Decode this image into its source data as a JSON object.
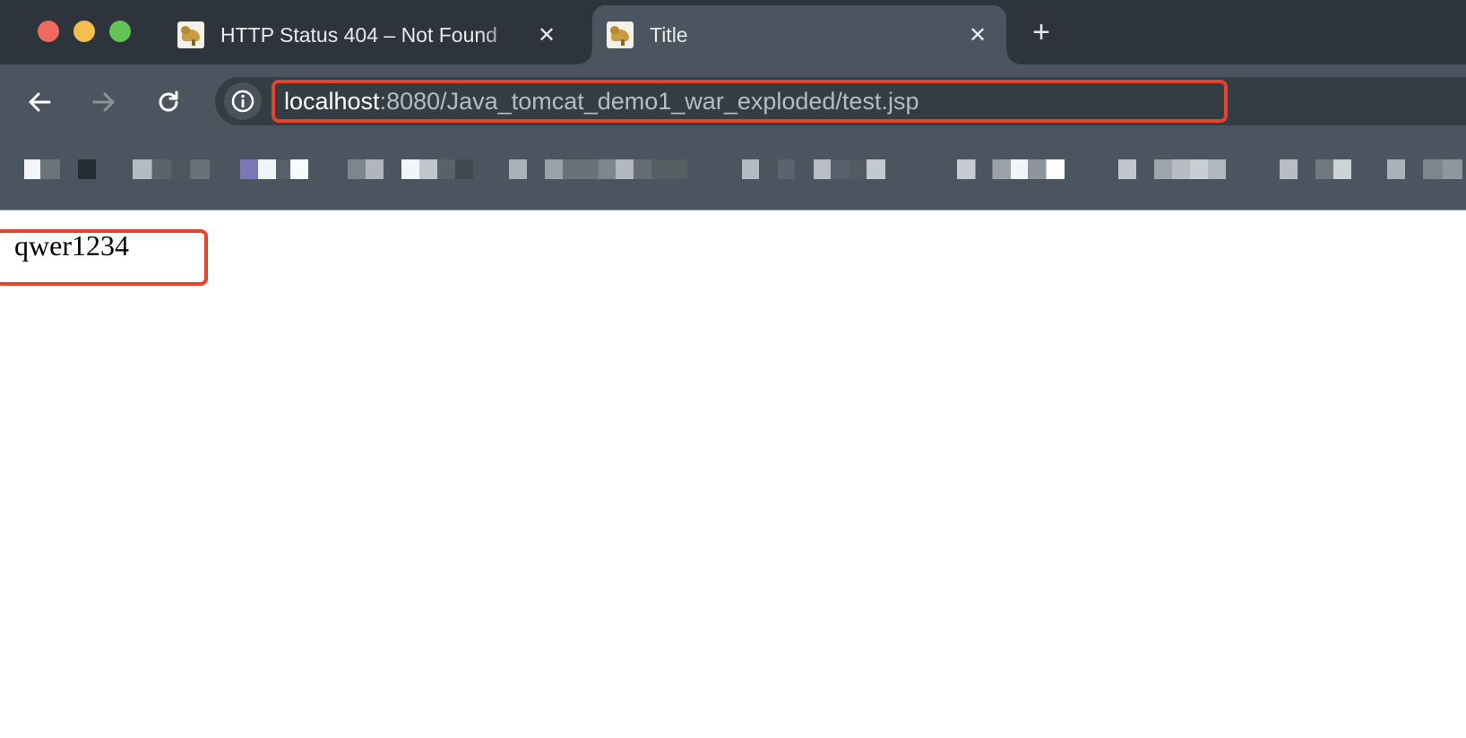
{
  "window": {
    "controls": [
      "close",
      "minimize",
      "zoom"
    ]
  },
  "tabs": [
    {
      "title": "HTTP Status 404 – Not Found",
      "icon": "tomcat-favicon",
      "active": false
    },
    {
      "title": "Title",
      "icon": "tomcat-favicon",
      "active": true
    }
  ],
  "tab_close_label": "✕",
  "new_tab_label": "+",
  "address_bar": {
    "host": "localhost",
    "path": ":8080/Java_tomcat_demo1_war_exploded/test.jsp",
    "info_icon": "info-icon"
  },
  "page": {
    "body_text": "qwer1234"
  },
  "colors": {
    "highlight": "#e8412c",
    "tabstrip": "#2d343b",
    "toolbar": "#4a555f",
    "omnibox": "#353d44"
  }
}
